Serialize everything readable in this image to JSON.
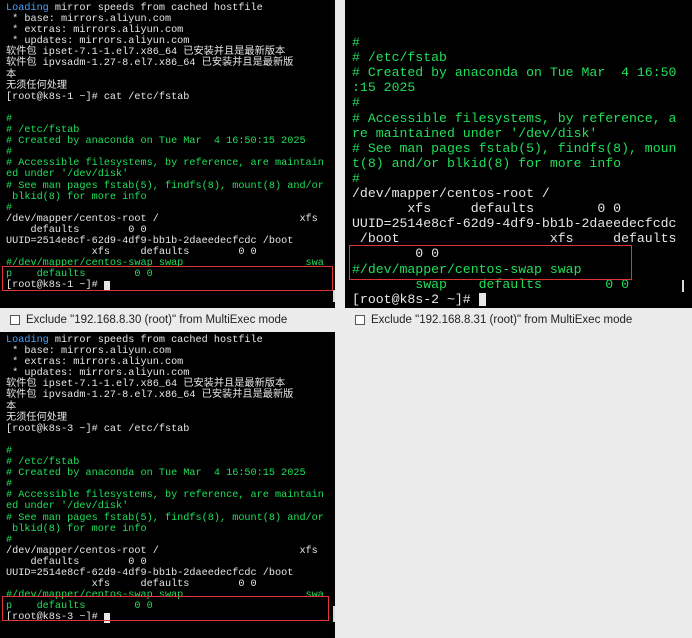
{
  "panes": {
    "p1": {
      "host": "192.168.8.30",
      "lines": [
        {
          "segs": [
            {
              "t": "Loading",
              "c": "b"
            },
            {
              "t": " mirror speeds from cached hostfile"
            }
          ]
        },
        {
          "segs": [
            {
              "t": " * base: mirrors.aliyun.com"
            }
          ]
        },
        {
          "segs": [
            {
              "t": " * extras: mirrors.aliyun.com"
            }
          ]
        },
        {
          "segs": [
            {
              "t": " * updates: mirrors.aliyun.com"
            }
          ]
        },
        {
          "segs": [
            {
              "t": "软件包 ipset-7.1-1.el7.x86_64 已安装并且是最新版本"
            }
          ]
        },
        {
          "segs": [
            {
              "t": "软件包 ipvsadm-1.27-8.el7.x86_64 已安装并且是最新版"
            }
          ]
        },
        {
          "segs": [
            {
              "t": "本"
            }
          ]
        },
        {
          "segs": [
            {
              "t": "无须任何处理"
            }
          ]
        },
        {
          "segs": [
            {
              "t": "[root@k8s-1 ~]# cat /etc/fstab"
            }
          ]
        },
        {
          "segs": [
            {
              "t": ""
            }
          ]
        },
        {
          "segs": [
            {
              "t": "#",
              "c": "c"
            }
          ]
        },
        {
          "segs": [
            {
              "t": "# /etc/fstab",
              "c": "c"
            }
          ]
        },
        {
          "segs": [
            {
              "t": "# Created by anaconda on Tue Mar  4 16:50:15 2025",
              "c": "c"
            }
          ]
        },
        {
          "segs": [
            {
              "t": "#",
              "c": "c"
            }
          ]
        },
        {
          "segs": [
            {
              "t": "# Accessible filesystems, by reference, are maintain",
              "c": "c"
            }
          ]
        },
        {
          "segs": [
            {
              "t": "ed under '/dev/disk'",
              "c": "c"
            }
          ]
        },
        {
          "segs": [
            {
              "t": "# See man pages fstab(5), findfs(8), mount(8) and/or",
              "c": "c"
            }
          ]
        },
        {
          "segs": [
            {
              "t": " blkid(8) for more info",
              "c": "c"
            }
          ]
        },
        {
          "segs": [
            {
              "t": "#",
              "c": "c"
            }
          ]
        },
        {
          "segs": [
            {
              "t": "/dev/mapper/centos-root /                       xfs"
            }
          ]
        },
        {
          "segs": [
            {
              "t": "    defaults        0 0"
            }
          ]
        },
        {
          "segs": [
            {
              "t": "UUID=2514e8cf-62d9-4df9-bb1b-2daeedecfcdc /boot"
            }
          ]
        },
        {
          "segs": [
            {
              "t": "              xfs     defaults        0 0"
            }
          ]
        },
        {
          "segs": [
            {
              "t": "#/dev/mapper/centos-swap swap                    swa",
              "c": "c"
            }
          ]
        },
        {
          "segs": [
            {
              "t": "p    defaults        0 0",
              "c": "c"
            }
          ]
        },
        {
          "segs": [
            {
              "t": "[root@k8s-1 ~]# "
            }
          ],
          "cursor": true
        }
      ]
    },
    "p2": {
      "host": "192.168.8.31",
      "lines": [
        {
          "segs": [
            {
              "t": ""
            }
          ]
        },
        {
          "segs": [
            {
              "t": "#",
              "c": "c"
            }
          ]
        },
        {
          "segs": [
            {
              "t": "# /etc/fstab",
              "c": "c"
            }
          ]
        },
        {
          "segs": [
            {
              "t": "# Created by anaconda on Tue Mar  4 16:50",
              "c": "c"
            }
          ]
        },
        {
          "segs": [
            {
              "t": ":15 2025",
              "c": "c"
            }
          ]
        },
        {
          "segs": [
            {
              "t": "#",
              "c": "c"
            }
          ]
        },
        {
          "segs": [
            {
              "t": "# Accessible filesystems, by reference, a",
              "c": "c"
            }
          ]
        },
        {
          "segs": [
            {
              "t": "re maintained under '/dev/disk'",
              "c": "c"
            }
          ]
        },
        {
          "segs": [
            {
              "t": "# See man pages fstab(5), findfs(8), moun",
              "c": "c"
            }
          ]
        },
        {
          "segs": [
            {
              "t": "t(8) and/or blkid(8) for more info",
              "c": "c"
            }
          ]
        },
        {
          "segs": [
            {
              "t": "#",
              "c": "c"
            }
          ]
        },
        {
          "segs": [
            {
              "t": "/dev/mapper/centos-root /"
            }
          ]
        },
        {
          "segs": [
            {
              "t": "       xfs     defaults        0 0"
            }
          ]
        },
        {
          "segs": [
            {
              "t": "UUID=2514e8cf-62d9-4df9-bb1b-2daeedecfcdc"
            }
          ]
        },
        {
          "segs": [
            {
              "t": " /boot                   xfs     defaults"
            }
          ]
        },
        {
          "segs": [
            {
              "t": "        0 0"
            }
          ]
        },
        {
          "segs": [
            {
              "t": "#/dev/mapper/centos-swap swap",
              "c": "c"
            }
          ]
        },
        {
          "segs": [
            {
              "t": "        swap    defaults        0 0",
              "c": "c"
            }
          ]
        },
        {
          "segs": [
            {
              "t": "[root@k8s-2 ~]# "
            }
          ],
          "cursor": true
        }
      ]
    },
    "p3": {
      "host": "192.168.8.30",
      "lines": [
        {
          "segs": [
            {
              "t": "Loading",
              "c": "b"
            },
            {
              "t": " mirror speeds from cached hostfile"
            }
          ]
        },
        {
          "segs": [
            {
              "t": " * base: mirrors.aliyun.com"
            }
          ]
        },
        {
          "segs": [
            {
              "t": " * extras: mirrors.aliyun.com"
            }
          ]
        },
        {
          "segs": [
            {
              "t": " * updates: mirrors.aliyun.com"
            }
          ]
        },
        {
          "segs": [
            {
              "t": "软件包 ipset-7.1-1.el7.x86_64 已安装并且是最新版本"
            }
          ]
        },
        {
          "segs": [
            {
              "t": "软件包 ipvsadm-1.27-8.el7.x86_64 已安装并且是最新版"
            }
          ]
        },
        {
          "segs": [
            {
              "t": "本"
            }
          ]
        },
        {
          "segs": [
            {
              "t": "无须任何处理"
            }
          ]
        },
        {
          "segs": [
            {
              "t": "[root@k8s-3 ~]# cat /etc/fstab"
            }
          ]
        },
        {
          "segs": [
            {
              "t": ""
            }
          ]
        },
        {
          "segs": [
            {
              "t": "#",
              "c": "c"
            }
          ]
        },
        {
          "segs": [
            {
              "t": "# /etc/fstab",
              "c": "c"
            }
          ]
        },
        {
          "segs": [
            {
              "t": "# Created by anaconda on Tue Mar  4 16:50:15 2025",
              "c": "c"
            }
          ]
        },
        {
          "segs": [
            {
              "t": "#",
              "c": "c"
            }
          ]
        },
        {
          "segs": [
            {
              "t": "# Accessible filesystems, by reference, are maintain",
              "c": "c"
            }
          ]
        },
        {
          "segs": [
            {
              "t": "ed under '/dev/disk'",
              "c": "c"
            }
          ]
        },
        {
          "segs": [
            {
              "t": "# See man pages fstab(5), findfs(8), mount(8) and/or",
              "c": "c"
            }
          ]
        },
        {
          "segs": [
            {
              "t": " blkid(8) for more info",
              "c": "c"
            }
          ]
        },
        {
          "segs": [
            {
              "t": "#",
              "c": "c"
            }
          ]
        },
        {
          "segs": [
            {
              "t": "/dev/mapper/centos-root /                       xfs"
            }
          ]
        },
        {
          "segs": [
            {
              "t": "    defaults        0 0"
            }
          ]
        },
        {
          "segs": [
            {
              "t": "UUID=2514e8cf-62d9-4df9-bb1b-2daeedecfcdc /boot"
            }
          ]
        },
        {
          "segs": [
            {
              "t": "              xfs     defaults        0 0"
            }
          ]
        },
        {
          "segs": [
            {
              "t": "#/dev/mapper/centos-swap swap                    swa",
              "c": "c"
            }
          ]
        },
        {
          "segs": [
            {
              "t": "p    defaults        0 0",
              "c": "c"
            }
          ]
        },
        {
          "segs": [
            {
              "t": "[root@k8s-3 ~]# "
            }
          ],
          "cursor": true
        }
      ]
    }
  },
  "exclude": {
    "p1": "Exclude \"192.168.8.30 (root)\" from MultiExec mode",
    "p2": "Exclude \"192.168.8.31 (root)\" from MultiExec mode"
  },
  "colors": {
    "terminal_bg": "#000000",
    "terminal_text": "#e6e6e6",
    "comment": "#1fe05a",
    "keyword": "#4aa0ff",
    "highlight_box": "#e03434"
  }
}
